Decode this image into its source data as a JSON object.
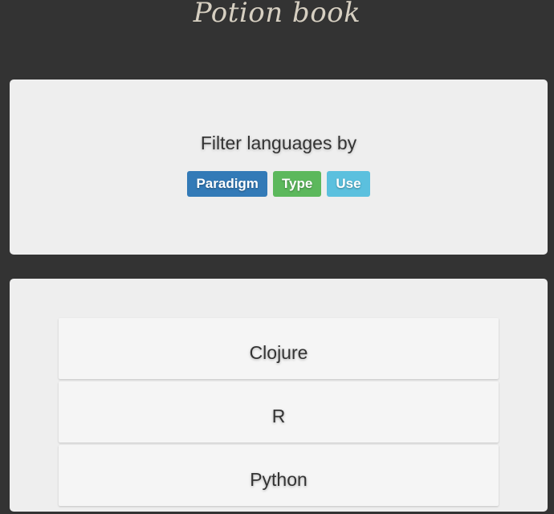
{
  "header": {
    "title": "Potion book"
  },
  "filter": {
    "heading": "Filter languages by",
    "buttons": [
      {
        "label": "Paradigm",
        "color": "#337ab7"
      },
      {
        "label": "Type",
        "color": "#5cb85c"
      },
      {
        "label": "Use",
        "color": "#5bc0de"
      }
    ]
  },
  "languages": [
    {
      "name": "Clojure"
    },
    {
      "name": "R"
    },
    {
      "name": "Python"
    }
  ],
  "colors": {
    "background": "#333333",
    "panel": "#eeeeee",
    "list_item": "#f5f5f5",
    "title": "#d6cfc1"
  }
}
